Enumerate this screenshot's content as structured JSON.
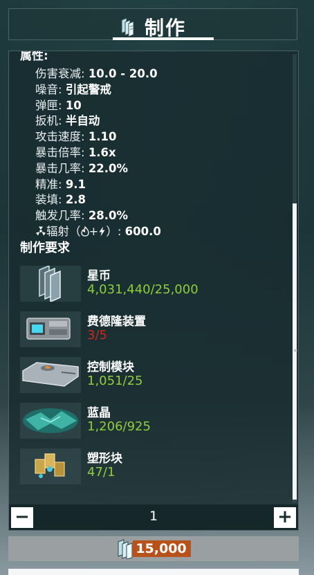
{
  "header": {
    "title": "制作",
    "icon": "credits-icon"
  },
  "attributes": {
    "heading": "属性:",
    "rows": [
      {
        "label": "伤害衰减: ",
        "value": "10.0 - 20.0"
      },
      {
        "label": "噪音: ",
        "value": "引起警戒"
      },
      {
        "label": "弹匣: ",
        "value": "10"
      },
      {
        "label": "扳机: ",
        "value": "半自动"
      },
      {
        "label": "攻击速度: ",
        "value": "1.10"
      },
      {
        "label": "暴击倍率: ",
        "value": "1.6x"
      },
      {
        "label": "暴击几率: ",
        "value": "22.0%"
      },
      {
        "label": "精准: ",
        "value": "9.1"
      },
      {
        "label": "装填: ",
        "value": "2.8"
      },
      {
        "label": "触发几率: ",
        "value": "28.0%"
      }
    ],
    "radiation": {
      "label": "辐射（",
      "mid": "+",
      "close": "）: ",
      "value": "600.0",
      "icons": [
        "radiation-icon",
        "heat-icon",
        "electricity-icon"
      ]
    }
  },
  "requirements": {
    "heading": "制作要求",
    "items": [
      {
        "name": "星币",
        "count": "4,031,440/25,000",
        "status": "ok",
        "icon": "credits-icon"
      },
      {
        "name": "费德隆装置",
        "count": "3/5",
        "status": "bad",
        "icon": "fieldron-icon"
      },
      {
        "name": "控制模块",
        "count": "1,051/25",
        "status": "ok",
        "icon": "control-module-icon"
      },
      {
        "name": "蓝晶",
        "count": "1,206/925",
        "status": "ok",
        "icon": "cryotic-icon"
      },
      {
        "name": "塑形块",
        "count": "47/1",
        "status": "ok",
        "icon": "plastids-icon"
      }
    ]
  },
  "stepper": {
    "minus": "−",
    "quantity": "1",
    "plus": "+"
  },
  "cost": {
    "value": "15,000",
    "icon": "credits-icon"
  },
  "colors": {
    "ok": "#8fce3a",
    "bad": "#c8281e",
    "cost_bg": "#b9521a"
  }
}
